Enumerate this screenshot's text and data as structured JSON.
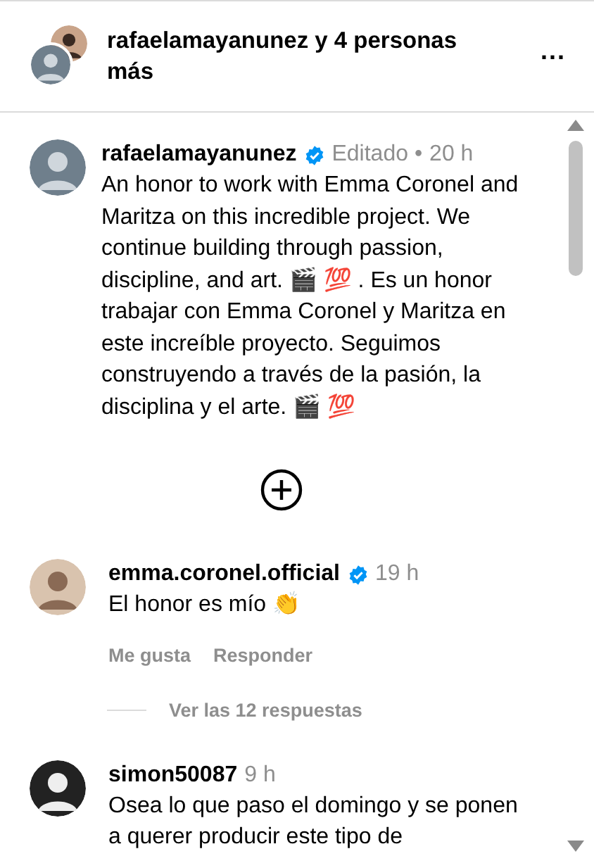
{
  "header": {
    "title": "rafaelamayanunez y 4 personas más",
    "more": "..."
  },
  "post": {
    "username": "rafaelamayanunez",
    "verified": true,
    "edited": "Editado •",
    "time": "20 h",
    "text": "An honor to work with Emma Coronel and Maritza on this incredible project. We continue building through passion, discipline, and art. 🎬 💯 . Es un honor trabajar con Emma Coronel y Maritza en este increíble proyecto. Seguimos construyendo a través de la pasión, la disciplina y el arte. 🎬 💯"
  },
  "comments": [
    {
      "username": "emma.coronel.official",
      "verified": true,
      "time": "19 h",
      "text": "El honor es mío 👏",
      "actions": [
        "Me gusta",
        "Responder"
      ],
      "replies": "Ver las 12 respuestas"
    },
    {
      "username": "simon50087",
      "verified": false,
      "time": "9 h",
      "text": "Osea lo que paso el domingo y se ponen a querer producir este tipo de"
    }
  ]
}
